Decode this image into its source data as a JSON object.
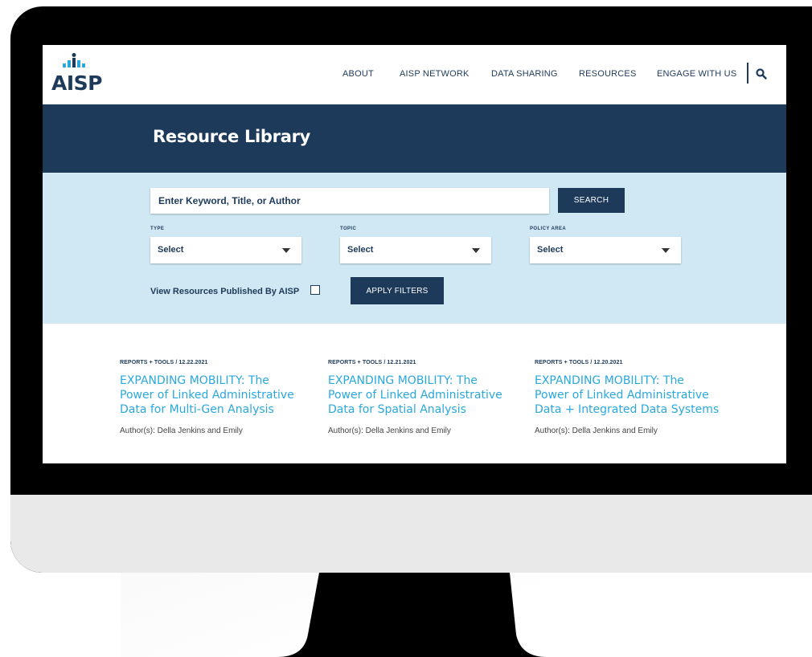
{
  "site": {
    "logo_text": "AISP",
    "nav": [
      "ABOUT",
      "AISP NETWORK",
      "DATA SHARING",
      "RESOURCES",
      "ENGAGE WITH US"
    ],
    "search_icon": "search-icon"
  },
  "banner": {
    "title": "Resource Library"
  },
  "filters": {
    "search_placeholder": "Enter Keyword, Title, or Author",
    "search_button": "SEARCH",
    "type_label": "TYPE",
    "type_value": "Select",
    "topic_label": "TOPIC",
    "topic_value": "Select",
    "policy_label": "POLICY AREA",
    "policy_value": "Select",
    "aisp_checkbox_label": "View Resources Published By AISP",
    "apply_button": "APPLY FILTERS"
  },
  "results": [
    {
      "meta": "REPORTS + TOOLS / 12.22.2021",
      "title": "EXPANDING MOBILITY: The Power of Linked Administrative Data for Multi-Gen Analysis",
      "authors": "Author(s): Della Jenkins and Emily"
    },
    {
      "meta": "REPORTS + TOOLS / 12.21.2021",
      "title": "EXPANDING MOBILITY: The Power of Linked Administrative Data for Spatial Analysis",
      "authors": "Author(s): Della Jenkins and Emily"
    },
    {
      "meta": "REPORTS + TOOLS / 12.20.2021",
      "title": "EXPANDING MOBILITY: The Power of Linked Administrative Data + Integrated Data Systems",
      "authors": "Author(s): Della Jenkins and Emily"
    }
  ],
  "colors": {
    "navy": "#1e3a5a",
    "light_blue": "#cfe8f4",
    "link_blue": "#2aa8de"
  }
}
